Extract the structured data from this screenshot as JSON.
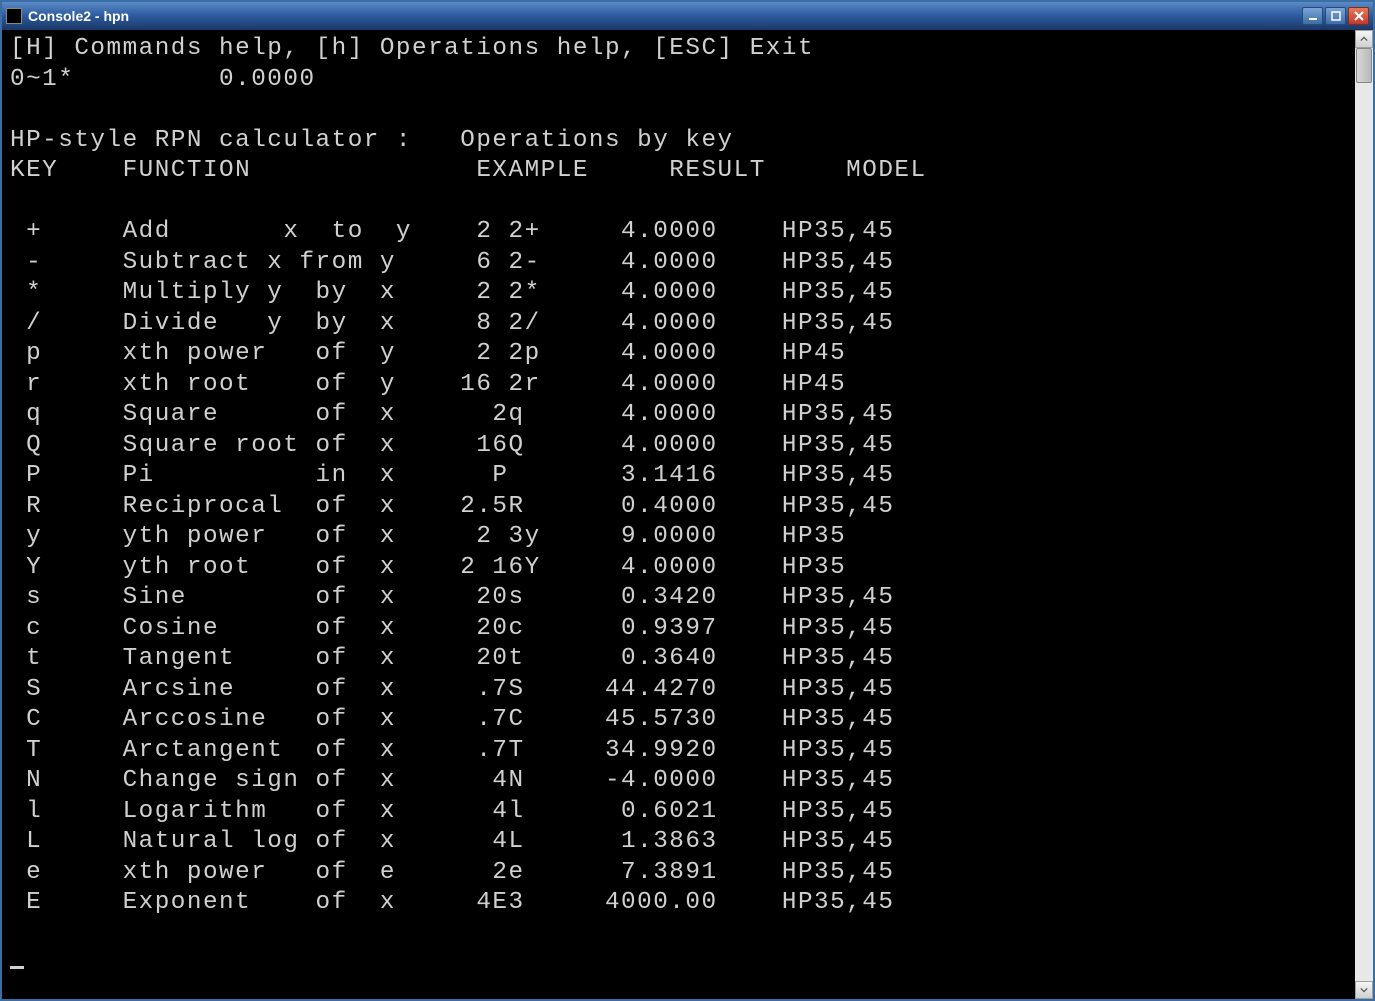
{
  "window": {
    "title": "Console2 - hpn"
  },
  "header": {
    "help_line": "[H] Commands help, [h] Operations help, [ESC] Exit",
    "stack_line": "0~1*         0.0000"
  },
  "section": {
    "title": "HP-style RPN calculator :   Operations by key",
    "columns": "KEY    FUNCTION              EXAMPLE     RESULT     MODEL"
  },
  "rows": [
    {
      "key": " +",
      "func": "Add       x  to  y",
      "ex": "  2 2+",
      "res": "   4.0000",
      "model": "HP35,45"
    },
    {
      "key": " -",
      "func": "Subtract x from y",
      "ex": "  6 2-",
      "res": "   4.0000",
      "model": "HP35,45"
    },
    {
      "key": " *",
      "func": "Multiply y  by  x",
      "ex": "  2 2*",
      "res": "   4.0000",
      "model": "HP35,45"
    },
    {
      "key": " /",
      "func": "Divide   y  by  x",
      "ex": "  8 2/",
      "res": "   4.0000",
      "model": "HP35,45"
    },
    {
      "key": " p",
      "func": "xth power   of  y",
      "ex": "  2 2p",
      "res": "   4.0000",
      "model": "HP45"
    },
    {
      "key": " r",
      "func": "xth root    of  y",
      "ex": " 16 2r",
      "res": "   4.0000",
      "model": "HP45"
    },
    {
      "key": " q",
      "func": "Square      of  x",
      "ex": "   2q ",
      "res": "   4.0000",
      "model": "HP35,45"
    },
    {
      "key": " Q",
      "func": "Square root of  x",
      "ex": "  16Q ",
      "res": "   4.0000",
      "model": "HP35,45"
    },
    {
      "key": " P",
      "func": "Pi          in  x",
      "ex": "   P  ",
      "res": "   3.1416",
      "model": "HP35,45"
    },
    {
      "key": " R",
      "func": "Reciprocal  of  x",
      "ex": " 2.5R ",
      "res": "   0.4000",
      "model": "HP35,45"
    },
    {
      "key": " y",
      "func": "yth power   of  x",
      "ex": "  2 3y",
      "res": "   9.0000",
      "model": "HP35"
    },
    {
      "key": " Y",
      "func": "yth root    of  x",
      "ex": " 2 16Y",
      "res": "   4.0000",
      "model": "HP35"
    },
    {
      "key": " s",
      "func": "Sine        of  x",
      "ex": "  20s ",
      "res": "   0.3420",
      "model": "HP35,45"
    },
    {
      "key": " c",
      "func": "Cosine      of  x",
      "ex": "  20c ",
      "res": "   0.9397",
      "model": "HP35,45"
    },
    {
      "key": " t",
      "func": "Tangent     of  x",
      "ex": "  20t ",
      "res": "   0.3640",
      "model": "HP35,45"
    },
    {
      "key": " S",
      "func": "Arcsine     of  x",
      "ex": "  .7S ",
      "res": "  44.4270",
      "model": "HP35,45"
    },
    {
      "key": " C",
      "func": "Arccosine   of  x",
      "ex": "  .7C ",
      "res": "  45.5730",
      "model": "HP35,45"
    },
    {
      "key": " T",
      "func": "Arctangent  of  x",
      "ex": "  .7T ",
      "res": "  34.9920",
      "model": "HP35,45"
    },
    {
      "key": " N",
      "func": "Change sign of  x",
      "ex": "   4N ",
      "res": "  -4.0000",
      "model": "HP35,45"
    },
    {
      "key": " l",
      "func": "Logarithm   of  x",
      "ex": "   4l ",
      "res": "   0.6021",
      "model": "HP35,45"
    },
    {
      "key": " L",
      "func": "Natural log of  x",
      "ex": "   4L ",
      "res": "   1.3863",
      "model": "HP35,45"
    },
    {
      "key": " e",
      "func": "xth power   of  e",
      "ex": "   2e ",
      "res": "   7.3891",
      "model": "HP35,45"
    },
    {
      "key": " E",
      "func": "Exponent    of  x",
      "ex": "  4E3 ",
      "res": "  4000.00",
      "model": "HP35,45"
    }
  ]
}
